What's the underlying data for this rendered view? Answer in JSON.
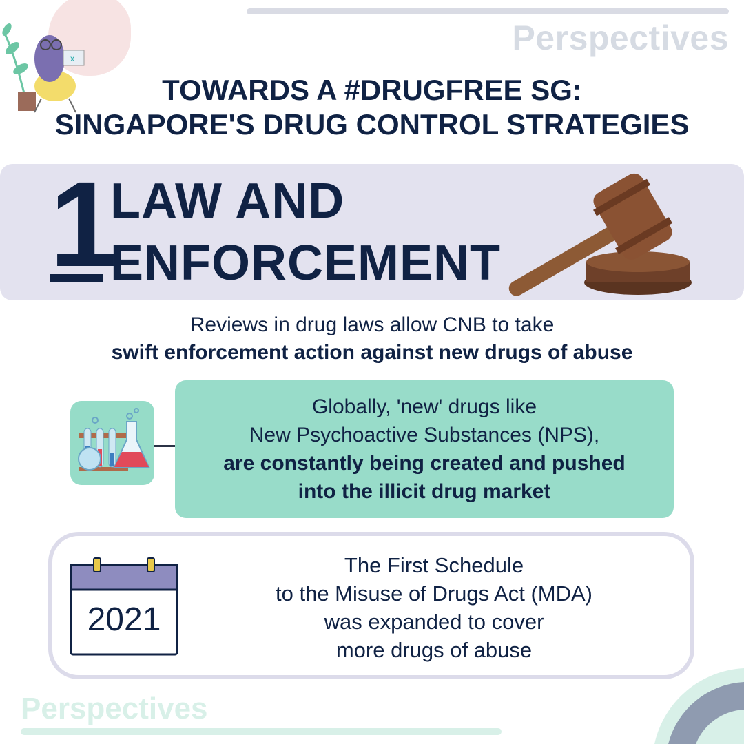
{
  "brand": {
    "top_label": "Perspectives",
    "bottom_label": "Perspectives"
  },
  "heading": {
    "line1": "TOWARDS A #DRUGFREE SG:",
    "line2": "SINGAPORE'S DRUG CONTROL STRATEGIES"
  },
  "section": {
    "number": "1",
    "title_line1": "LAW AND",
    "title_line2": "ENFORCEMENT"
  },
  "review": {
    "line1": "Reviews in drug laws allow CNB to take",
    "line2_bold": "swift enforcement action against new drugs of abuse"
  },
  "nps_card": {
    "line1": "Globally, 'new' drugs like",
    "line2": "New Psychoactive Substances (NPS),",
    "line3_bold": "are constantly being created and pushed",
    "line4_bold": "into the illicit drug market"
  },
  "mda_card": {
    "year": "2021",
    "line1": "The First Schedule",
    "line2": "to the Misuse of Drugs Act (MDA)",
    "line3": "was expanded to cover",
    "line4": "more drugs of abuse"
  },
  "icons": [
    "person-at-laptop-illustration",
    "gavel-icon",
    "lab-flask-icon",
    "calendar-icon"
  ],
  "colors": {
    "navy": "#102244",
    "banner_lavender": "#e3e2ef",
    "card_green": "#98dcc9",
    "outline_lavender": "#dcdbea",
    "calendar_header": "#8e8cbf"
  }
}
